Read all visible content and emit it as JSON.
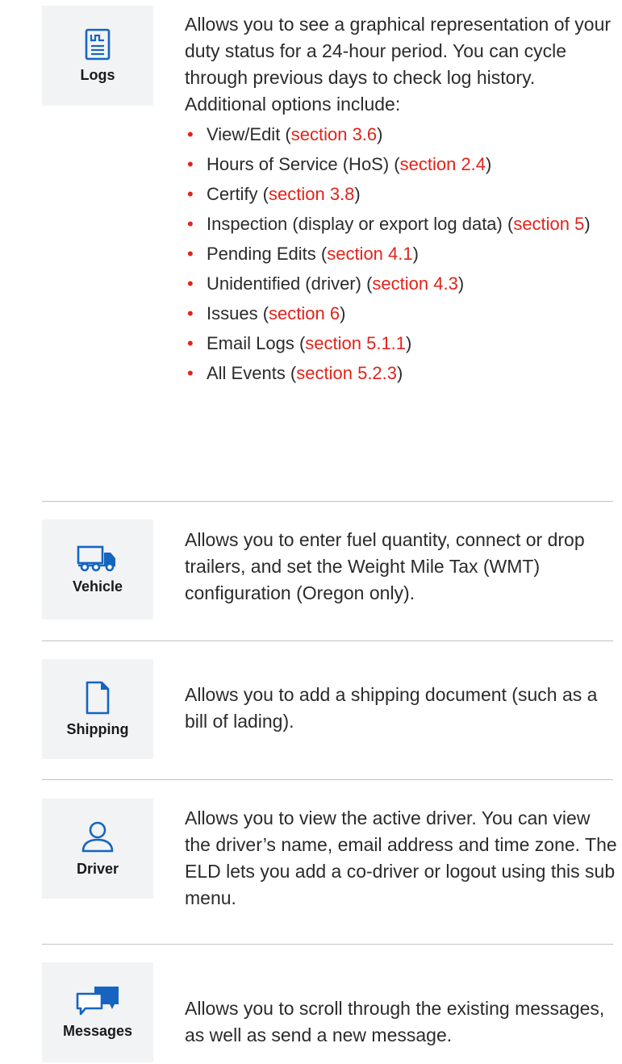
{
  "logs": {
    "label": "Logs",
    "description": "Allows you to see a graphical representation of your duty status for a 24-hour period. You can cycle through previous days to check log history. Additional options include:",
    "options": [
      {
        "text": "View/Edit (",
        "link": "section 3.6",
        "close": ")"
      },
      {
        "text": "Hours of Service (HoS) (",
        "link": "section 2.4",
        "close": ")"
      },
      {
        "text": "Certify (",
        "link": "section 3.8",
        "close": ")"
      },
      {
        "text": "Inspection (display or export log data) (",
        "link": "section 5",
        "close": ")"
      },
      {
        "text": "Pending Edits (",
        "link": "section 4.1",
        "close": ")"
      },
      {
        "text": "Unidentified (driver) (",
        "link": "section 4.3",
        "close": ")"
      },
      {
        "text": "Issues (",
        "link": "section 6",
        "close": ")"
      },
      {
        "text": "Email Logs (",
        "link": "section 5.1.1",
        "close": ")"
      },
      {
        "text": "All Events (",
        "link": "section 5.2.3",
        "close": ")"
      }
    ]
  },
  "vehicle": {
    "label": "Vehicle",
    "description": "Allows you to enter fuel quantity, connect or drop trailers, and set the Weight Mile Tax (WMT) configuration (Oregon only)."
  },
  "shipping": {
    "label": "Shipping",
    "description": "Allows you to add a shipping document (such as a bill of lading)."
  },
  "driver": {
    "label": "Driver",
    "description": "Allows you to view the active driver. You can view the driver’s name, email address and time zone. The ELD lets you add a co-driver or logout using this sub menu."
  },
  "messages": {
    "label": "Messages",
    "description": "Allows you to scroll through the existing messages, as well as send a new message."
  },
  "icons": {
    "logs": "log-document-icon",
    "vehicle": "truck-icon",
    "shipping": "document-icon",
    "driver": "person-icon",
    "messages": "chat-bubbles-icon"
  },
  "colors": {
    "accent_link": "#e2231a",
    "icon_blue": "#1565c0",
    "tile_bg": "#f2f3f4",
    "divider": "#bfc3c6"
  }
}
